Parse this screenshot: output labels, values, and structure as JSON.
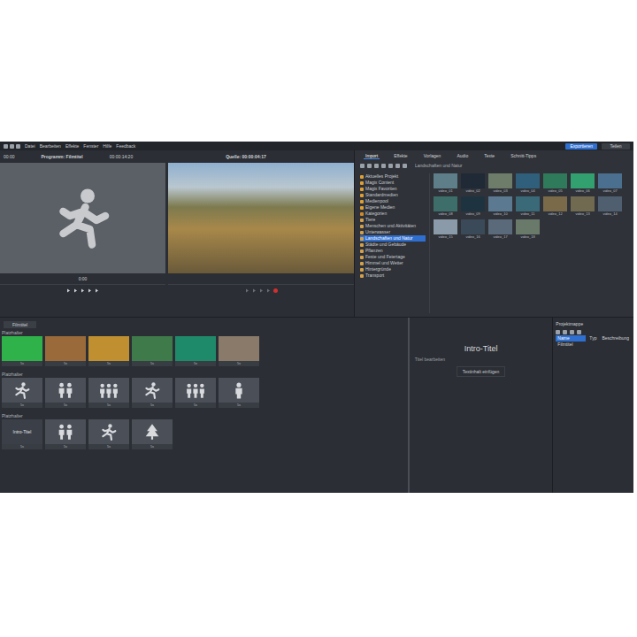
{
  "menu": [
    "Datei",
    "Bearbeiten",
    "Effekte",
    "Fenster",
    "Hilfe",
    "Feedback"
  ],
  "top_buttons": [
    {
      "label": "Exportieren",
      "primary": true
    },
    {
      "label": "Teilen",
      "primary": false
    }
  ],
  "program_monitor": {
    "time": "00:00",
    "title": "Programm: Filmtitel",
    "timecode": "00:00:14:20",
    "position": "0:00"
  },
  "source_monitor": {
    "title": "Quelle: 00:00:04:17"
  },
  "media_tabs": [
    {
      "label": "Import",
      "selected": true
    },
    {
      "label": "Effekte",
      "selected": false
    },
    {
      "label": "Vorlagen",
      "selected": false
    },
    {
      "label": "Audio",
      "selected": false
    },
    {
      "label": "Texte",
      "selected": false
    },
    {
      "label": "Schnitt-Tipps",
      "selected": false
    }
  ],
  "path": "Landschaften und Natur",
  "folders": [
    {
      "label": "Aktuelles Projekt",
      "color": "#e0a030",
      "selected": false
    },
    {
      "label": "Magix Content",
      "color": "#e0a030",
      "selected": false
    },
    {
      "label": "Magix Favoriten",
      "color": "#e0a030",
      "selected": false
    },
    {
      "label": "Standardmedien",
      "color": "#e0a030",
      "selected": false
    },
    {
      "label": "Medienpool",
      "color": "#e0a030",
      "selected": false
    },
    {
      "label": "Eigene Medien",
      "color": "#e0a030",
      "selected": false
    },
    {
      "label": "Kategorien",
      "color": "#d08a2a",
      "selected": false
    },
    {
      "label": "Tiere",
      "color": "#d4a04a",
      "selected": false
    },
    {
      "label": "Menschen und Aktivitäten",
      "color": "#d4a04a",
      "selected": false
    },
    {
      "label": "Unterwasser",
      "color": "#d4a04a",
      "selected": false
    },
    {
      "label": "Landschaften und Natur",
      "color": "#d4a04a",
      "selected": true
    },
    {
      "label": "Städte und Gebäude",
      "color": "#d4a04a",
      "selected": false
    },
    {
      "label": "Pflanzen",
      "color": "#d4a04a",
      "selected": false
    },
    {
      "label": "Feste und Feiertage",
      "color": "#d4a04a",
      "selected": false
    },
    {
      "label": "Himmel und Wetter",
      "color": "#d4a04a",
      "selected": false
    },
    {
      "label": "Hintergründe",
      "color": "#d4a04a",
      "selected": false
    },
    {
      "label": "Transport",
      "color": "#d4a04a",
      "selected": false
    }
  ],
  "thumbnails": [
    {
      "caption": "video_01",
      "color": "#5e7f8a"
    },
    {
      "caption": "video_02",
      "color": "#1f2a36"
    },
    {
      "caption": "video_03",
      "color": "#6d7d6a"
    },
    {
      "caption": "video_04",
      "color": "#2f5f7a"
    },
    {
      "caption": "video_05",
      "color": "#2f7a5a"
    },
    {
      "caption": "video_06",
      "color": "#33a070"
    },
    {
      "caption": "video_07",
      "color": "#4a6f8f"
    },
    {
      "caption": "video_08",
      "color": "#3d6e6a"
    },
    {
      "caption": "video_09",
      "color": "#1e3340"
    },
    {
      "caption": "video_10",
      "color": "#5b7a92"
    },
    {
      "caption": "video_11",
      "color": "#3a6a78"
    },
    {
      "caption": "video_12",
      "color": "#7a6a4a"
    },
    {
      "caption": "video_13",
      "color": "#6f6a50"
    },
    {
      "caption": "video_14",
      "color": "#4f5f70"
    },
    {
      "caption": "video_15",
      "color": "#8a9aa8"
    },
    {
      "caption": "video_16",
      "color": "#3a4a58"
    },
    {
      "caption": "video_17",
      "color": "#5a6a7a"
    },
    {
      "caption": "video_18",
      "color": "#6a7a6a"
    }
  ],
  "storyboard": {
    "tab": "Filmtitel",
    "rows": [
      {
        "label": "Platzhalter",
        "clips": [
          {
            "kind": "photo",
            "color": "#2fb24a",
            "duration": "5s",
            "text": ""
          },
          {
            "kind": "photo",
            "color": "#9a6a3a",
            "duration": "5s",
            "text": ""
          },
          {
            "kind": "photo",
            "color": "#c09030",
            "duration": "5s",
            "text": ""
          },
          {
            "kind": "photo",
            "color": "#3f7a4a",
            "duration": "5s",
            "text": ""
          },
          {
            "kind": "photo",
            "color": "#1f8a6a",
            "duration": "5s",
            "text": ""
          },
          {
            "kind": "photo",
            "color": "#8a7a6a",
            "duration": "5s",
            "text": ""
          }
        ]
      },
      {
        "label": "Platzhalter",
        "clips": [
          {
            "kind": "runner",
            "color": "#4a4f58",
            "duration": "5s",
            "text": ""
          },
          {
            "kind": "pair",
            "color": "#4a4f58",
            "duration": "5s",
            "text": ""
          },
          {
            "kind": "group",
            "color": "#4a4f58",
            "duration": "5s",
            "text": ""
          },
          {
            "kind": "runner",
            "color": "#4a4f58",
            "duration": "5s",
            "text": ""
          },
          {
            "kind": "group",
            "color": "#4a4f58",
            "duration": "5s",
            "text": ""
          },
          {
            "kind": "person",
            "color": "#4a4f58",
            "duration": "5s",
            "text": ""
          }
        ]
      },
      {
        "label": "Platzhalter",
        "clips": [
          {
            "kind": "title",
            "color": "#3a3f48",
            "duration": "5s",
            "text": "Intro-Titel"
          },
          {
            "kind": "pair",
            "color": "#4a4f58",
            "duration": "5s",
            "text": ""
          },
          {
            "kind": "runner",
            "color": "#4a4f58",
            "duration": "5s",
            "text": ""
          },
          {
            "kind": "tree",
            "color": "#4a4f58",
            "duration": "5s",
            "text": ""
          }
        ]
      }
    ]
  },
  "title_panel": {
    "heading": "Intro-Titel",
    "label": "Titel bearbeiten",
    "field": "Textinhalt einfügen"
  },
  "project_panel": {
    "title": "Projektmappe",
    "columns": [
      {
        "label": "Name",
        "selected": true
      },
      {
        "label": "Typ",
        "selected": false
      },
      {
        "label": "Beschreibung",
        "selected": false
      }
    ],
    "rows": [
      [
        "Filmtitel",
        "",
        ""
      ]
    ]
  }
}
